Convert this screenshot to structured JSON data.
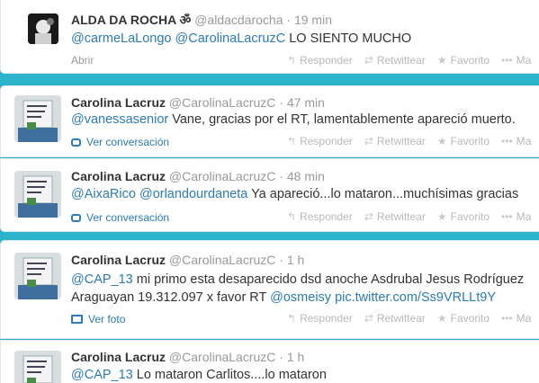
{
  "tweets": [
    {
      "fullname": "ALDA DA ROCHA ॐ",
      "username": "@aldacdarocha",
      "time": "19 min",
      "text_parts": [
        "@carmeLaLongo",
        " ",
        "@CarolinaLacruzC",
        " LO SIENTO MUCHO"
      ],
      "expand": "Abrir"
    },
    {
      "fullname": "Carolina Lacruz",
      "username": "@CarolinaLacruzC",
      "time": "47 min",
      "text_parts": [
        "@vanessasenior",
        " Vane, gracias por el RT, lamentablemente apareció muerto."
      ],
      "expand": "Ver conversación"
    },
    {
      "fullname": "Carolina Lacruz",
      "username": "@CarolinaLacruzC",
      "time": "48 min",
      "text_parts": [
        "@AixaRico",
        " ",
        "@orlandourdaneta",
        " Ya apareció...lo mataron...muchísimas gracias"
      ],
      "expand": "Ver conversación"
    },
    {
      "fullname": "Carolina Lacruz",
      "username": "@CarolinaLacruzC",
      "time": "1 h",
      "line1_parts": [
        "@CAP_13",
        " mi primo esta desaparecido dsd anoche Asdrubal Jesus Rodríguez"
      ],
      "line2_parts": [
        "Araguayan 19.312.097 x favor RT ",
        "@osmeisy",
        " ",
        "pic.twitter.com/Ss9VRLLt9Y"
      ],
      "expand": "Ver foto"
    },
    {
      "fullname": "Carolina Lacruz",
      "username": "@CarolinaLacruzC",
      "time": "1 h",
      "text_parts": [
        "@CAP_13",
        " Lo mataron Carlitos....lo mataron"
      ]
    }
  ],
  "actions": {
    "reply": "Responder",
    "retweet": "Retwittear",
    "favorite": "Favorito",
    "more": "Ma"
  }
}
